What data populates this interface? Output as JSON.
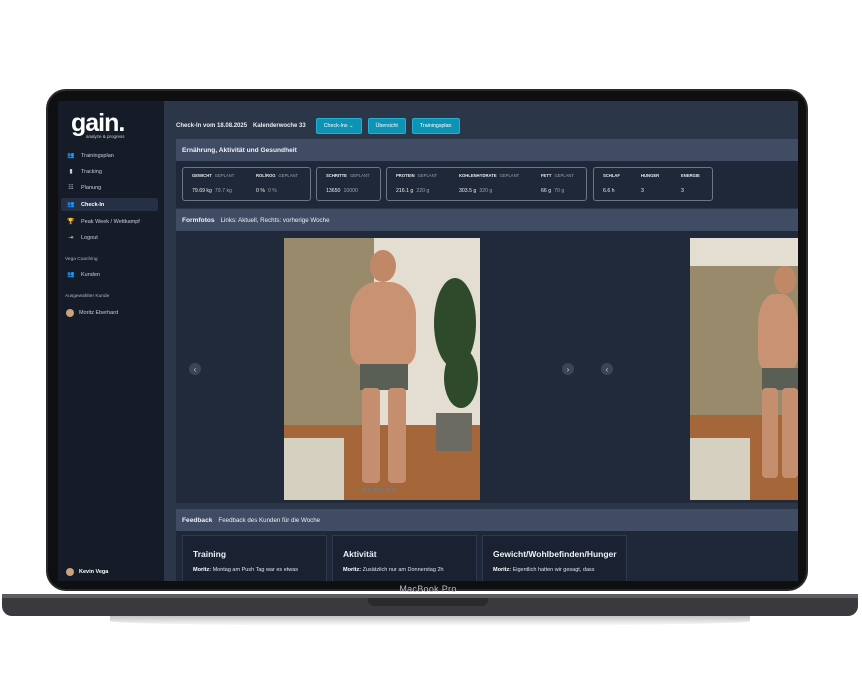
{
  "device": {
    "label": "MacBook Pro"
  },
  "sidebar": {
    "logo": "gain.",
    "logo_sub": "analyze & progress",
    "items": [
      {
        "icon": "users-icon",
        "label": "Trainingsplan"
      },
      {
        "icon": "bar-chart-icon",
        "label": "Tracking"
      },
      {
        "icon": "people-icon",
        "label": "Planung"
      },
      {
        "icon": "check-in-icon",
        "label": "Check-In"
      },
      {
        "icon": "trophy-icon",
        "label": "Peak Week / Wettkampf"
      },
      {
        "icon": "logout-icon",
        "label": "Logout"
      }
    ],
    "section_coaching": "Vega Coaching",
    "kunden_label": "Kunden",
    "section_selected": "Ausgewählter Kunde",
    "selected_client": "Moritz Eberhard",
    "user_name": "Kevin Vega"
  },
  "topbar": {
    "checkin_label": "Check-In vom 18.08.2025",
    "week_label": "Kalenderwoche 33",
    "btn_checkins": "Check-Ins",
    "btn_uebersicht": "Übersicht",
    "btn_trainingsplan": "Trainingsplan"
  },
  "nutrition": {
    "title": "Ernährung, Aktivität und Gesundheit",
    "gewicht_h": "GEWICHT",
    "gewicht_p": "GEPLANT",
    "gewicht_v": "79.69 kg",
    "gewicht_pv": "79.7 kg",
    "rol_h": "ROL/ROG",
    "rol_p": "GEPLANT",
    "rol_v": "0 %",
    "rol_pv": "0 %",
    "schritte_h": "SCHRITTE",
    "schritte_p": "GEPLANT",
    "schritte_v": "13650",
    "schritte_pv": "10000",
    "protein_h": "PROTEIN",
    "protein_p": "GEPLANT",
    "protein_v": "216.1 g",
    "protein_pv": "220 g",
    "kh_h": "KOHLENHYDRATE",
    "kh_p": "GEPLANT",
    "kh_v": "303.5 g",
    "kh_pv": "320 g",
    "fett_h": "FETT",
    "fett_p": "GEPLANT",
    "fett_v": "66 g",
    "fett_pv": "70 g",
    "schlaf_h": "SCHLAF",
    "schlaf_v": "6.6 h",
    "hunger_h": "HUNGER",
    "hunger_v": "3",
    "energie_h": "ENERGIE",
    "energie_v": "3"
  },
  "photos": {
    "title": "Formfotos",
    "subtitle": "Links: Aktuell, Rechts: vorherige Woche"
  },
  "feedback": {
    "title": "Feedback",
    "subtitle": "Feedback des Kunden für die Woche",
    "cards": [
      {
        "title": "Training",
        "author": "Moritz:",
        "text": "Montag am Push Tag war es etwas"
      },
      {
        "title": "Aktivität",
        "author": "Moritz:",
        "text": "Zusätzlich nur am Donnerstag 2h"
      },
      {
        "title": "Gewicht/Wohlbefinden/Hunger",
        "author": "Moritz:",
        "text": "Eigentlich hatten wir gesagt, dass"
      }
    ]
  },
  "colors": {
    "accent": "#0e93b5",
    "sidebar_bg": "#151c28",
    "panel_bg": "#1f2838",
    "header_bg": "#3f4c63"
  }
}
